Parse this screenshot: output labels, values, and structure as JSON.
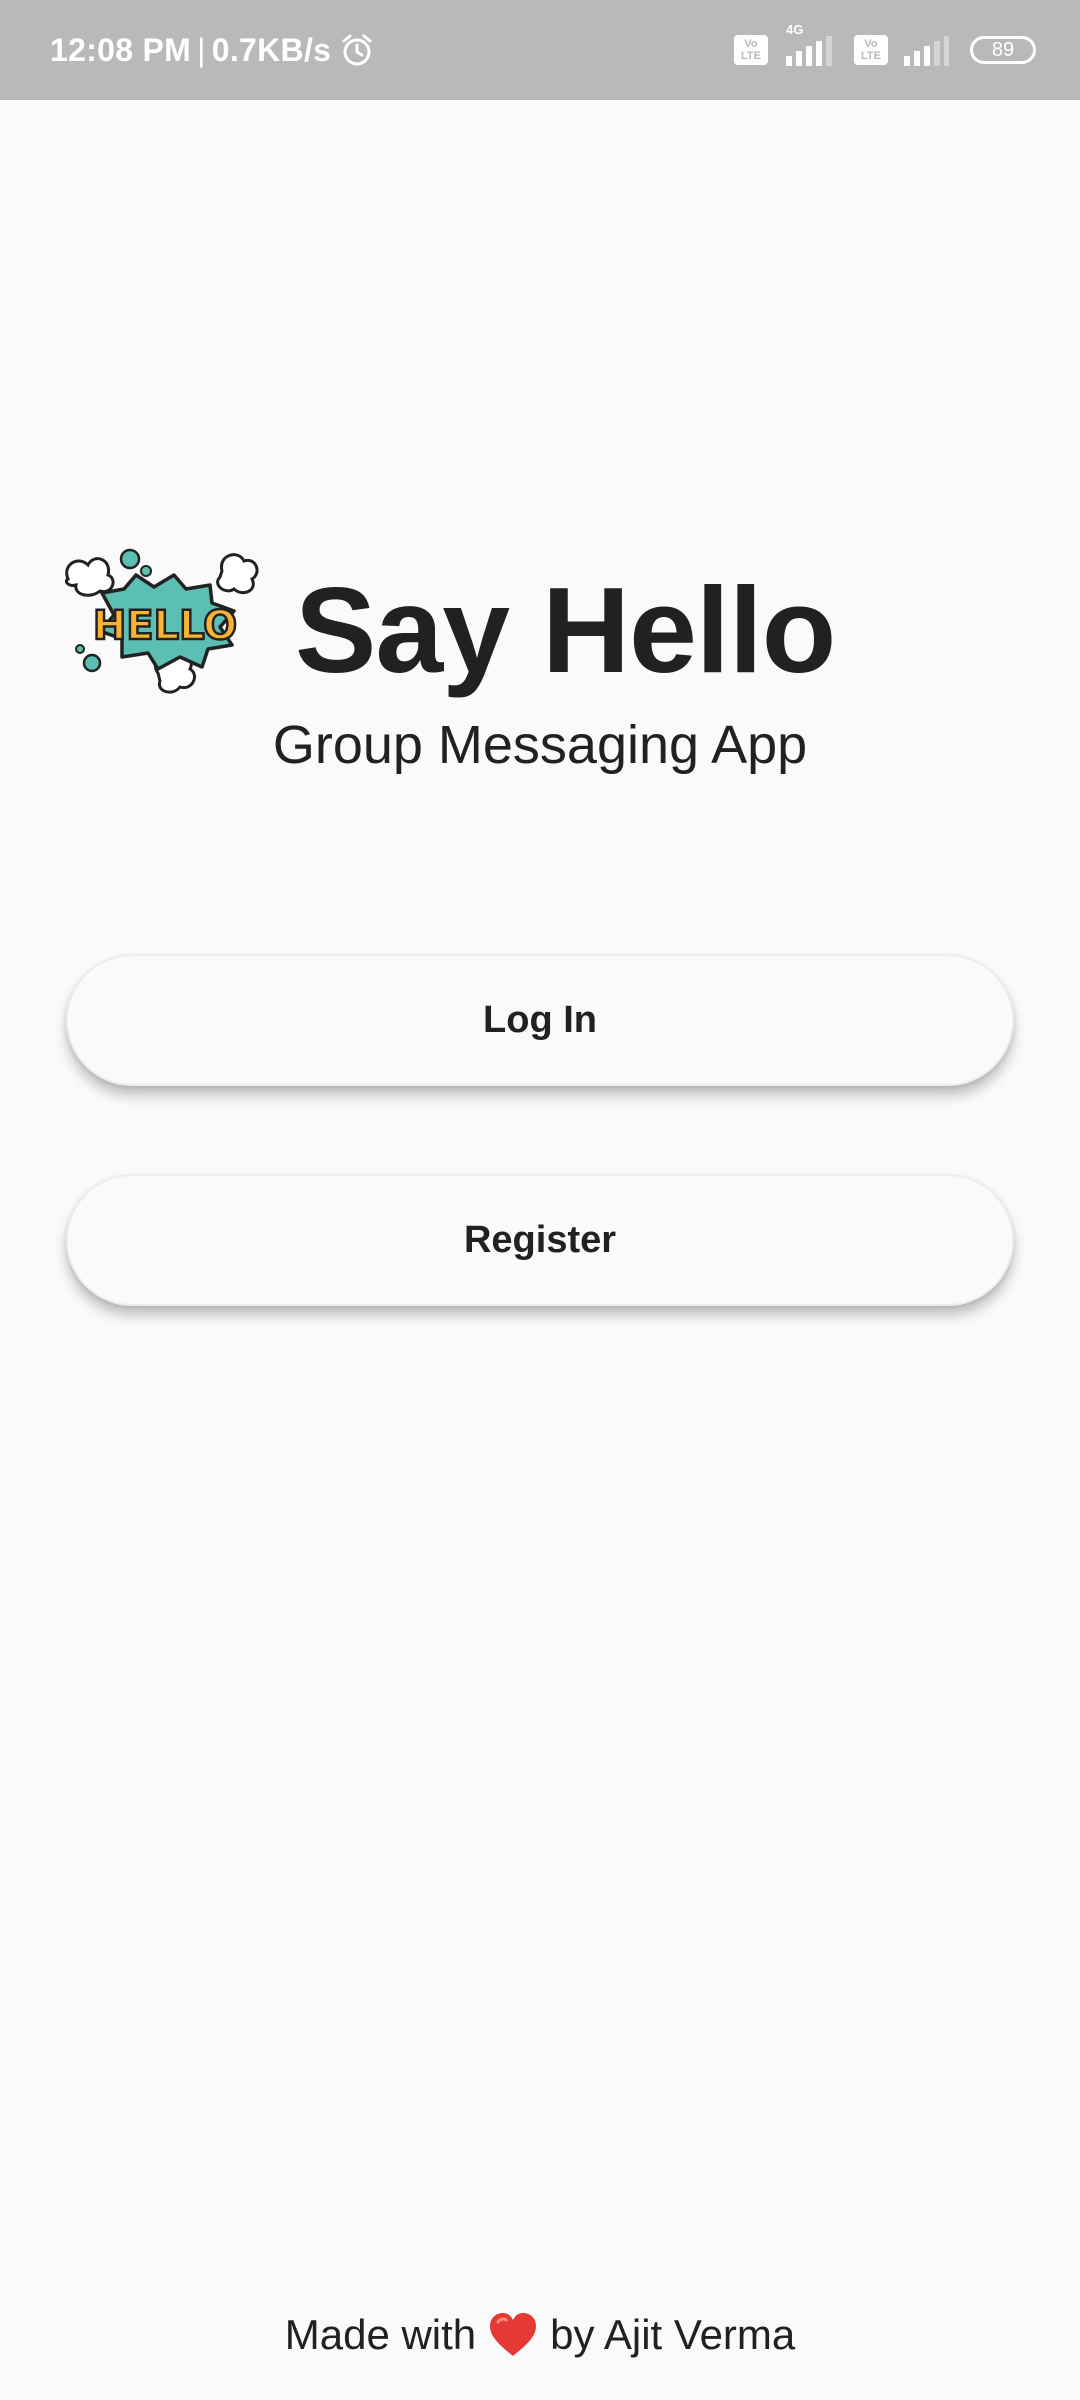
{
  "status_bar": {
    "time": "12:08 PM",
    "separator": "|",
    "net_speed": "0.7KB/s",
    "volte_top": "Vo",
    "volte_bottom": "LTE",
    "network_type": "4G",
    "battery": "89",
    "icons": [
      "alarm-icon",
      "volte-icon",
      "signal-icon",
      "volte-icon",
      "signal-icon",
      "battery-icon"
    ]
  },
  "brand": {
    "logo_text": "HELLO",
    "title": "Say Hello",
    "subtitle": "Group Messaging App"
  },
  "buttons": {
    "login_label": "Log In",
    "register_label": "Register"
  },
  "footer": {
    "prefix": "Made with",
    "suffix": "by Ajit Verma",
    "heart_icon": "heart-icon"
  },
  "colors": {
    "background": "#fafafa",
    "status_bar": "#b9b9b9",
    "text": "#212121",
    "heart": "#e53935",
    "logo_yellow": "#f9b233",
    "logo_teal": "#5bbfb3"
  }
}
